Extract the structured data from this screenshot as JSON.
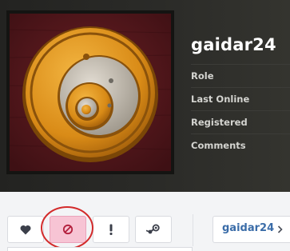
{
  "profile": {
    "username": "gaidar24",
    "info_labels": [
      "Role",
      "Last Online",
      "Registered",
      "Comments"
    ]
  },
  "actions": [
    {
      "name": "favorite-button",
      "icon": "heart-icon"
    },
    {
      "name": "block-button",
      "icon": "block-icon",
      "active": true
    },
    {
      "name": "report-button",
      "icon": "exclamation-icon"
    },
    {
      "name": "steam-button",
      "icon": "steam-icon"
    }
  ],
  "user_chip": {
    "label": "gaidar24",
    "icon": "chevron-right-icon"
  },
  "colors": {
    "header_bg": "#2b2b28",
    "username": "#ffffff",
    "info_label": "#d4d4d0",
    "active_button": "#f7c4d4",
    "highlight_ring": "#d32b2b",
    "link": "#3a6ca8"
  }
}
